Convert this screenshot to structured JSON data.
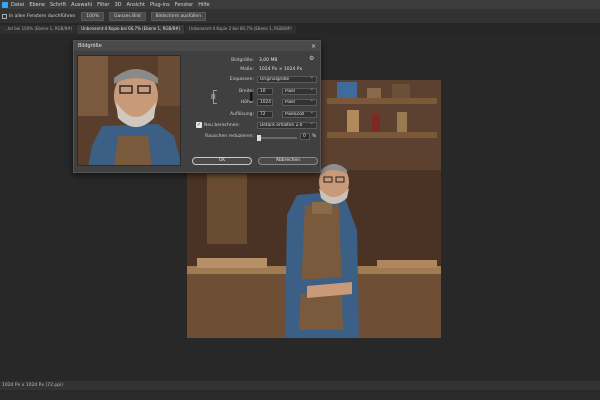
{
  "menubar": {
    "items": [
      "Datei",
      "Ebene",
      "Schrift",
      "Auswahl",
      "Filter",
      "3D",
      "Ansicht",
      "Plug-ins",
      "Fenster",
      "Hilfe"
    ]
  },
  "options_bar": {
    "text": "In allen Fenstern durchführen",
    "zoom": "100%",
    "fit_button": "Ganzes Bild",
    "fill_button": "Bildschirm ausfüllen"
  },
  "tabs": [
    {
      "label": "...tel bei 100% (Ebene 1, RGB/8#)",
      "active": false
    },
    {
      "label": "Unbenannt-4 Kopie bei 66,7% (Ebene 1, RGB/8#)",
      "active": true
    },
    {
      "label": "Unbenannt-4 Kopie 2 bei 66,7% (Ebene 1, RGB/8#)",
      "active": false
    }
  ],
  "status_bar": {
    "text": "1024 Px x 1024 Px (72 ppi)"
  },
  "dialog": {
    "title": "Bildgröße",
    "close": "×",
    "bildgroesse_label": "Bildgröße:",
    "bildgroesse_value": "3,00 MB",
    "masse_label": "Maße:",
    "masse_value": "1024 Px × 1024 Px",
    "einpassen_label": "Einpassen:",
    "einpassen_value": "Originalgröße",
    "breite_label": "Breite:",
    "breite_value": "10",
    "breite_unit": "Pixel",
    "hoehe_label": "Höhe:",
    "hoehe_value": "1024",
    "hoehe_unit": "Pixel",
    "aufloesung_label": "Auflösung:",
    "aufloesung_value": "72",
    "aufloesung_unit": "Pixel/Zoll",
    "neu_berechnen_label": "Neu berechnen:",
    "neu_berechnen_checked": true,
    "neu_berechnen_value": "Details erhalten 2.0",
    "rauschen_label": "Rauschen reduzieren:",
    "rauschen_value": "0",
    "rauschen_unit": "%",
    "rauschen_level": 0.0,
    "ok_label": "OK",
    "cancel_label": "Abbrechen"
  }
}
